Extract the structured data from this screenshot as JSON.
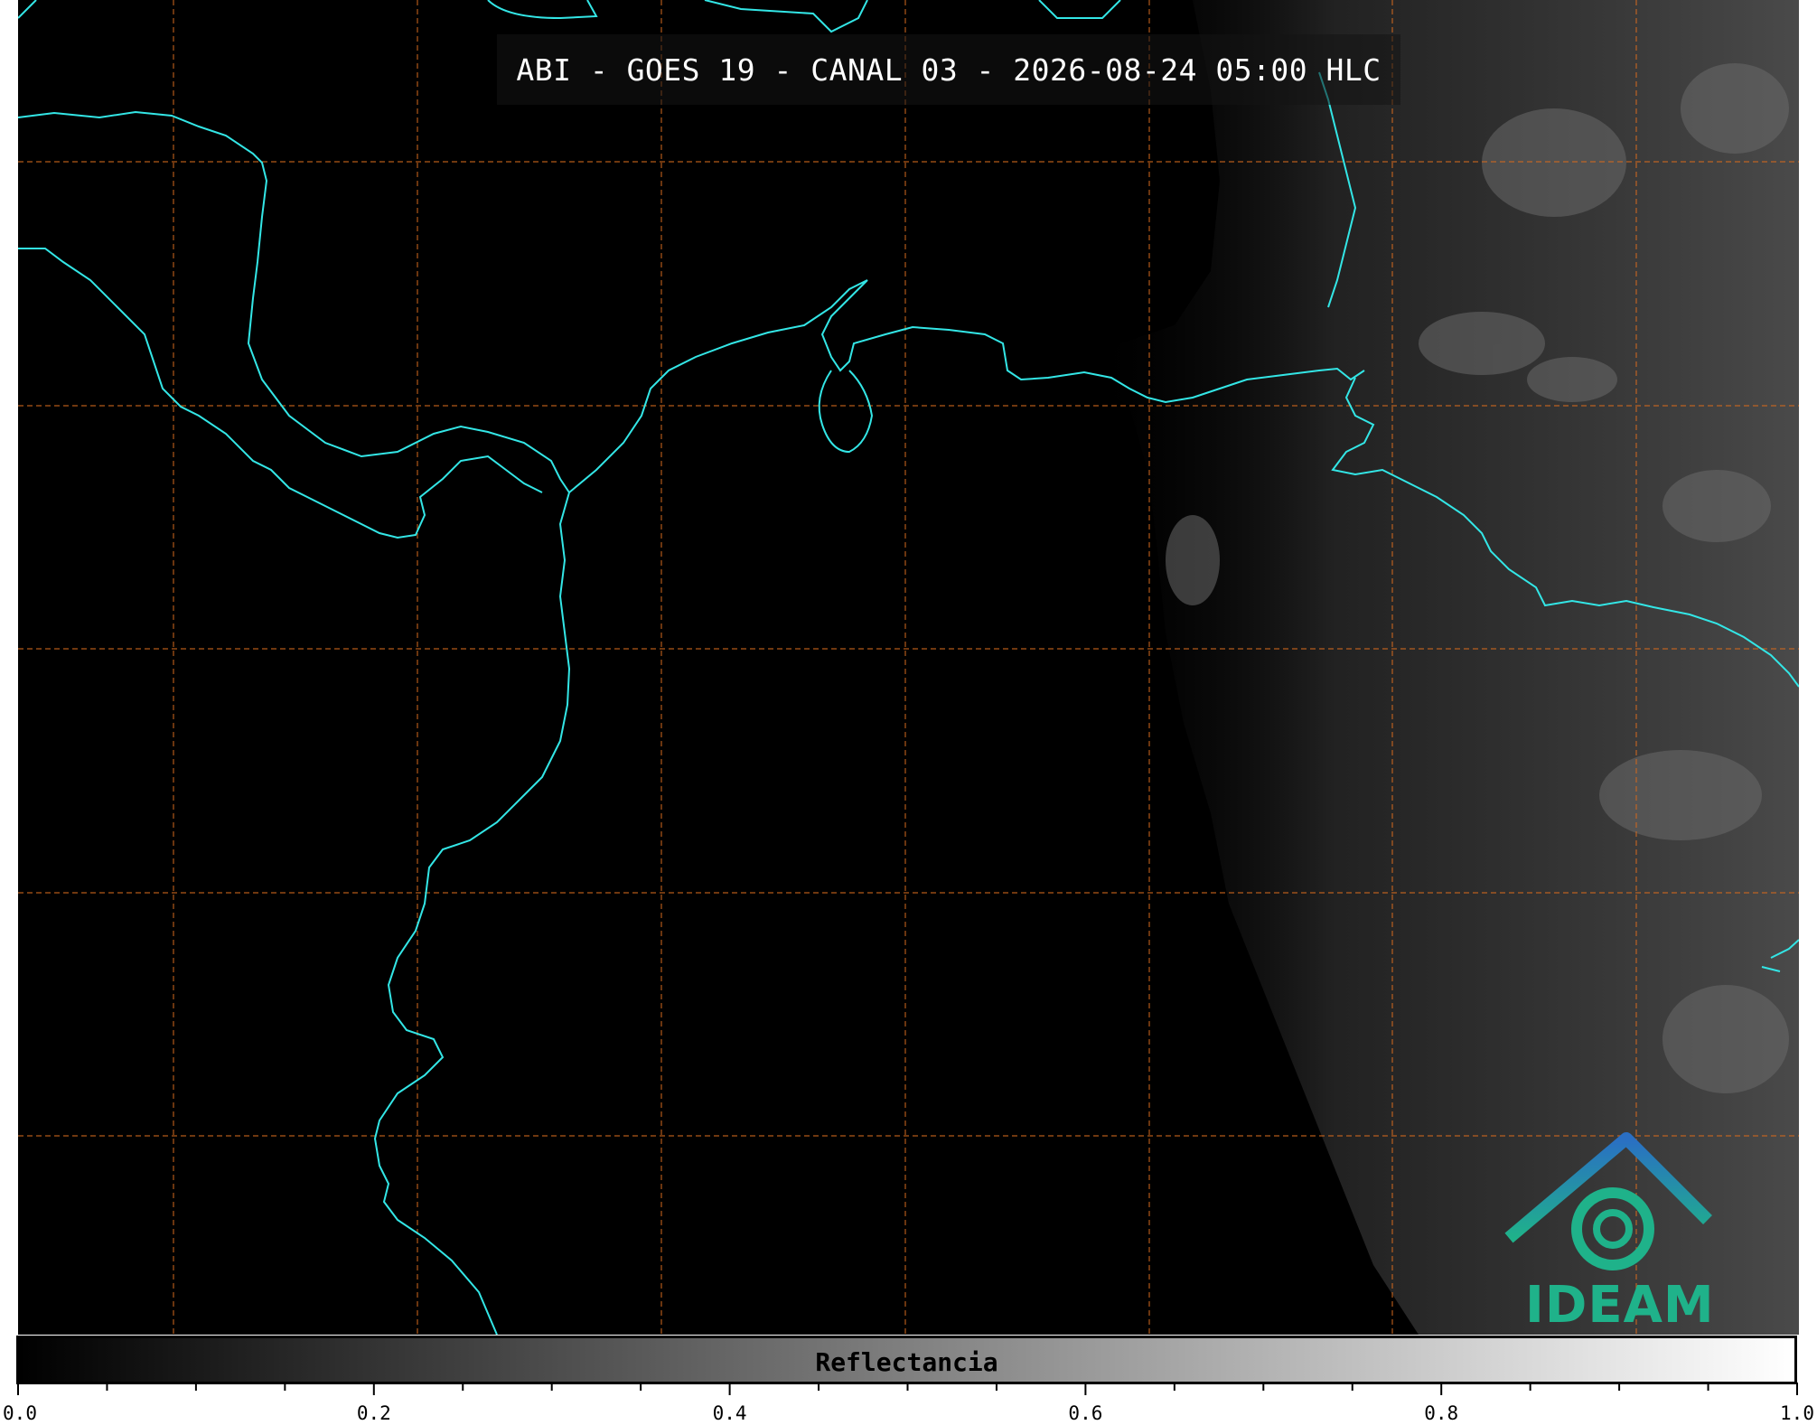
{
  "title": "ABI - GOES 19 - CANAL 03 - 2026-08-24 05:00 HLC",
  "logo": {
    "text": "IDEAM"
  },
  "colorbar": {
    "label": "Reflectancia",
    "min": 0.0,
    "max": 1.0,
    "major_ticks": [
      "0.0",
      "0.2",
      "0.4",
      "0.6",
      "0.8",
      "1.0"
    ],
    "minor_step": 0.05
  },
  "colors": {
    "background": "#000000",
    "coastline": "#33e6e6",
    "gridlines": "#d2691e",
    "logo_blue": "#2a7fc0",
    "logo_green": "#1fb28a"
  },
  "map": {
    "gridlines": "dashed",
    "coastlines": true
  }
}
